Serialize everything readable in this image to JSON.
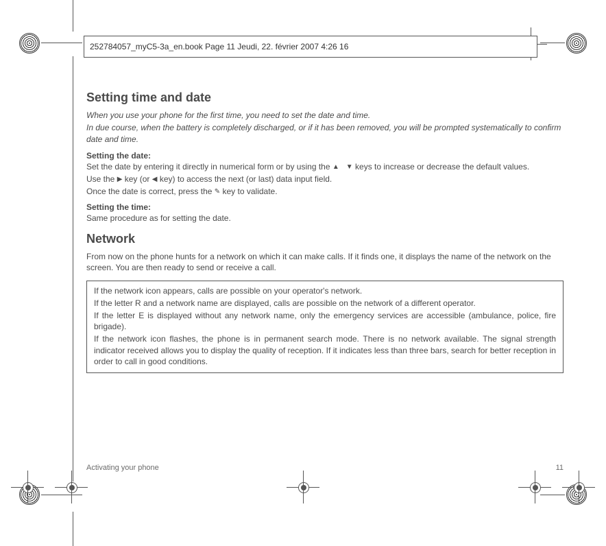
{
  "header": {
    "text": "252784057_myC5-3a_en.book  Page 11  Jeudi, 22. février 2007  4:26 16"
  },
  "content": {
    "title1": "Setting time and date",
    "intro1": "When you use your phone for the first time, you need to set the date and time.",
    "intro2": "In due course, when the battery is completely discharged, or if it has been removed, you will be prompted systematically to confirm date and time.",
    "setDateHeading": "Setting the date:",
    "setDate1a": "Set the date by entering it directly in numerical form or by using the ",
    "setDate1b": " keys to increase or decrease the default values.",
    "setDate2a": "Use the ",
    "setDate2b": " key (or ",
    "setDate2c": " key) to access the next (or last) data input field.",
    "setDate3a": "Once the date is correct, press the ",
    "setDate3b": " key to validate.",
    "setTimeHeading": "Setting the time:",
    "setTime1": "Same procedure as for setting the date.",
    "title2": "Network",
    "network1": "From now on the phone hunts for a network on which it can make calls. If it finds one, it displays the name of the network on the screen. You are then ready to send or receive a call.",
    "box1": "If the network icon appears, calls are possible on your operator's network.",
    "box2": "If the letter R and a network name are displayed, calls are possible on the network of a different operator.",
    "box3": "If the letter E is displayed without any network name, only the emergency services are accessible (ambulance, police, fire brigade).",
    "box4": "If the network icon flashes, the phone is in permanent search mode. There is no network available. The signal strength indicator received allows you to display the quality of reception. If it indicates less than three bars, search for better reception in order to call in good conditions."
  },
  "footer": {
    "section": "Activating your phone",
    "page": "11"
  },
  "icons": {
    "up": "▲",
    "down": "▼",
    "right": "▶",
    "left": "◀",
    "ok": "✎"
  }
}
